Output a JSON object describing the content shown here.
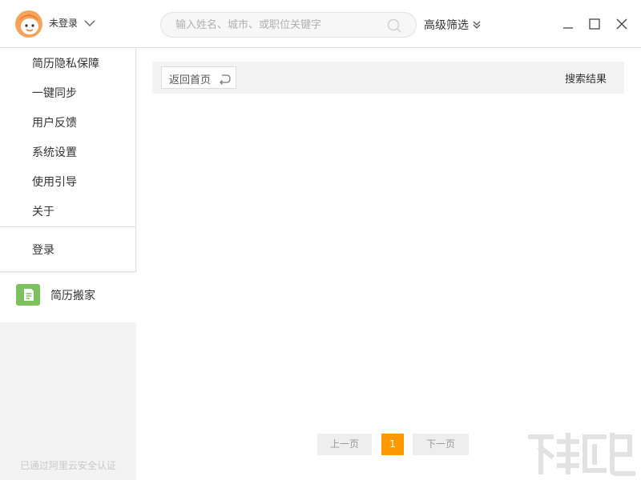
{
  "header": {
    "user_label": "未登录",
    "search_placeholder": "输入姓名、城市、或职位关键字",
    "search_value": "",
    "filter_label": "高级筛选"
  },
  "sidebar": {
    "items": [
      {
        "label": "简历隐私保障"
      },
      {
        "label": "一键同步"
      },
      {
        "label": "用户反馈"
      },
      {
        "label": "系统设置"
      },
      {
        "label": "使用引导"
      },
      {
        "label": "关于"
      }
    ],
    "login_label": "登录",
    "resume_move_label": "简历搬家",
    "security_note": "已通过阿里云安全认证"
  },
  "main": {
    "back_home_label": "返回首页",
    "results_label": "搜索结果"
  },
  "pagination": {
    "prev_label": "上一页",
    "current_page": "1",
    "next_label": "下一页"
  },
  "colors": {
    "accent": "#ff9900",
    "resume_move_icon": "#7dc15e"
  }
}
